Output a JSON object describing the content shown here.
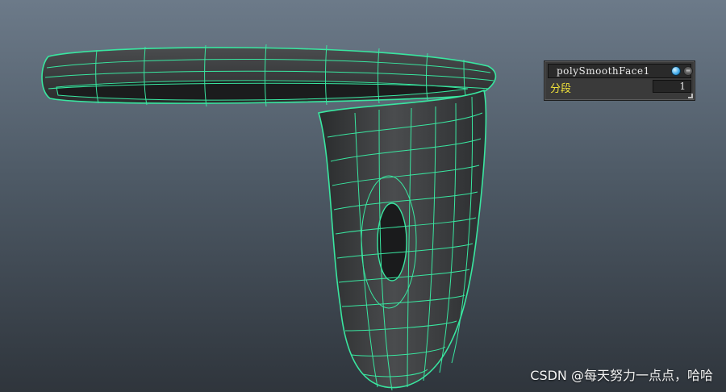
{
  "hud": {
    "node_name": "polySmoothFace1",
    "attribute_label": "分段",
    "attribute_value": "1",
    "icons": {
      "node_icon": "sphere-icon",
      "menu_icon": "menu-icon"
    }
  },
  "watermark": {
    "text": "CSDN @每天努力一点点，哈哈"
  },
  "colors": {
    "wireframe": "#39e6a0",
    "mesh_fill": "#3d3f40",
    "attr_label": "#f0e23a"
  }
}
